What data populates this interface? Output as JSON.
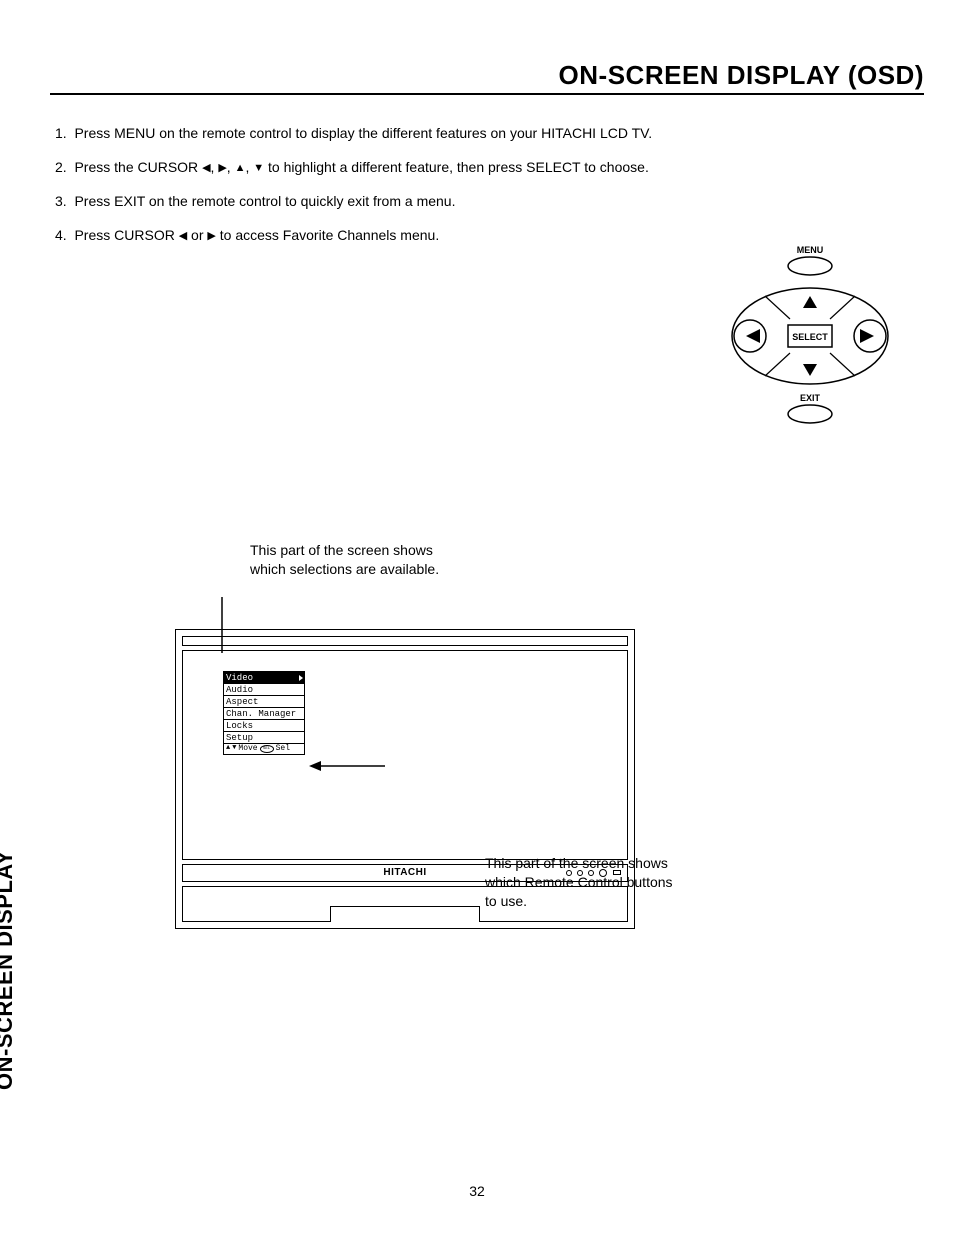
{
  "header": {
    "title": "ON-SCREEN DISPLAY (OSD)"
  },
  "instructions": [
    {
      "num": "1.",
      "text": "Press MENU on the remote control to display the different features on your HITACHI LCD TV."
    },
    {
      "num": "2.",
      "text_pre": "Press the CURSOR ",
      "text_post": " to highlight a different feature, then press SELECT to choose."
    },
    {
      "num": "3.",
      "text": "Press EXIT on the remote control to quickly exit from a menu."
    },
    {
      "num": "4.",
      "text_pre": "Press CURSOR ",
      "text_post": " to access Favorite Channels menu."
    }
  ],
  "remote": {
    "menu_label": "MENU",
    "select_label": "SELECT",
    "exit_label": "EXIT"
  },
  "annotations": {
    "top_line1": "This part of the screen shows",
    "top_line2": "which selections are available.",
    "right_line1": "This part of the screen shows",
    "right_line2": "which Remote Control buttons",
    "right_line3": "to use."
  },
  "osd_menu": {
    "items": [
      "Video",
      "Audio",
      "Aspect",
      "Chan. Manager",
      "Locks",
      "Setup"
    ],
    "hint_move": "Move",
    "hint_sel_btn": "SEL",
    "hint_sel": "Sel"
  },
  "tv": {
    "brand": "HITACHI"
  },
  "side_tab": "ON-SCREEN DISPLAY",
  "page_number": "32"
}
